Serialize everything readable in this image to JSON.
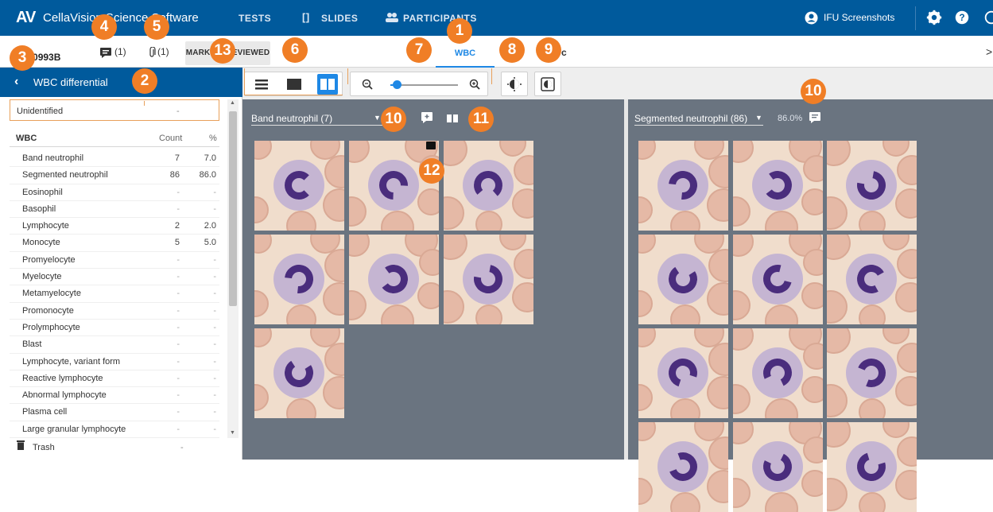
{
  "topbar": {
    "logo": "AV",
    "app_name": "CellaVision Science Software",
    "nav": [
      {
        "label": "TESTS"
      },
      {
        "label": "SLIDES"
      },
      {
        "label": "PARTICIPANTS"
      }
    ],
    "user_label": "IFU Screenshots",
    "icons": [
      "account-icon",
      "gear-icon",
      "help-icon"
    ]
  },
  "subbar": {
    "slide_id": "3000993B",
    "comments_count": "(1)",
    "attachments_count": "(1)",
    "mark_reviewed_label": "MARK AS REVIEWED",
    "tab_wbc": "WBC",
    "tab_other": "c",
    "close_glyph": ">"
  },
  "sidebar": {
    "title": "WBC differential",
    "unidentified_label": "Unidentified",
    "unidentified_value": "-",
    "header": {
      "name": "WBC",
      "count": "Count",
      "percent": "%"
    },
    "rows": [
      {
        "name": "Band neutrophil",
        "count": "7",
        "percent": "7.0"
      },
      {
        "name": "Segmented neutrophil",
        "count": "86",
        "percent": "86.0"
      },
      {
        "name": "Eosinophil",
        "count": "-",
        "percent": "-"
      },
      {
        "name": "Basophil",
        "count": "-",
        "percent": "-"
      },
      {
        "name": "Lymphocyte",
        "count": "2",
        "percent": "2.0"
      },
      {
        "name": "Monocyte",
        "count": "5",
        "percent": "5.0"
      },
      {
        "name": "Promyelocyte",
        "count": "-",
        "percent": "-"
      },
      {
        "name": "Myelocyte",
        "count": "-",
        "percent": "-"
      },
      {
        "name": "Metamyelocyte",
        "count": "-",
        "percent": "-"
      },
      {
        "name": "Promonocyte",
        "count": "-",
        "percent": "-"
      },
      {
        "name": "Prolymphocyte",
        "count": "-",
        "percent": "-"
      },
      {
        "name": "Blast",
        "count": "-",
        "percent": "-"
      },
      {
        "name": "Lymphocyte, variant form",
        "count": "-",
        "percent": "-"
      },
      {
        "name": "Reactive lymphocyte",
        "count": "-",
        "percent": "-"
      },
      {
        "name": "Abnormal lymphocyte",
        "count": "-",
        "percent": "-"
      },
      {
        "name": "Plasma cell",
        "count": "-",
        "percent": "-"
      },
      {
        "name": "Large granular lymphocyte",
        "count": "-",
        "percent": "-"
      }
    ],
    "trash_label": "Trash",
    "trash_value": "-"
  },
  "left_panel": {
    "category": "Band neutrophil (7)"
  },
  "right_panel": {
    "category": "Segmented neutrophil (86)",
    "percent": "86.0%"
  },
  "callouts": [
    "1",
    "2",
    "3",
    "4",
    "5",
    "6",
    "7",
    "8",
    "9",
    "10",
    "10",
    "11",
    "12",
    "13"
  ],
  "colors": {
    "brand_blue": "#005a9c",
    "accent_blue": "#1e88e5",
    "callout_orange": "#f07e26",
    "viewer_bg": "#6a7480"
  }
}
